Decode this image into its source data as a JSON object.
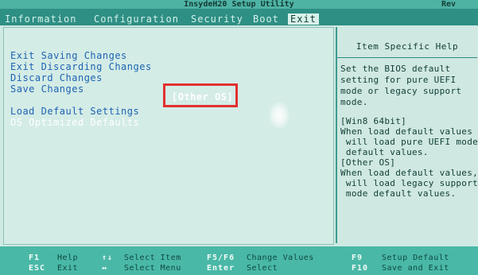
{
  "title": "InsydeH20 Setup Utility",
  "revision": "Rev",
  "tabs": [
    {
      "label": "Information"
    },
    {
      "label": "Configuration"
    },
    {
      "label": "Security"
    },
    {
      "label": "Boot"
    },
    {
      "label": "Exit"
    }
  ],
  "active_tab": "Exit",
  "menu": [
    {
      "label": "Exit Saving Changes"
    },
    {
      "label": "Exit Discarding Changes"
    },
    {
      "label": "Discard Changes"
    },
    {
      "label": "Save Changes"
    },
    {
      "label": "Load Default Settings"
    },
    {
      "label": "OS Optimized Defaults"
    }
  ],
  "selected_item_value": "[Other OS]",
  "help": {
    "title": "Item Specific Help",
    "lines": [
      "Set the BIOS default",
      "setting for pure UEFI",
      "mode or legacy support",
      "mode.",
      "",
      "[Win8 64bit]",
      "When load default values",
      " will load pure UEFI mode",
      " default values.",
      "[Other OS]",
      "When load default values,",
      " will load legacy support",
      " mode default values."
    ]
  },
  "footer": {
    "keys": [
      {
        "key": "F1",
        "desc": "Help"
      },
      {
        "key": "ESC",
        "desc": "Exit"
      },
      {
        "key": "↑↓",
        "desc": "Select Item"
      },
      {
        "key": "↔",
        "desc": "Select Menu"
      },
      {
        "key": "F5/F6",
        "desc": "Change Values"
      },
      {
        "key": "Enter",
        "desc": "Select"
      },
      {
        "key": "F9",
        "desc": "Setup Default"
      },
      {
        "key": "F10",
        "desc": "Save and Exit"
      }
    ]
  },
  "colors": {
    "tab_bar": "#2e8f84",
    "panel_bg": "#d4ece6",
    "menu_text": "#1d63b2",
    "highlight_box": "#e33030",
    "footer_bg": "#4ab8a7"
  }
}
